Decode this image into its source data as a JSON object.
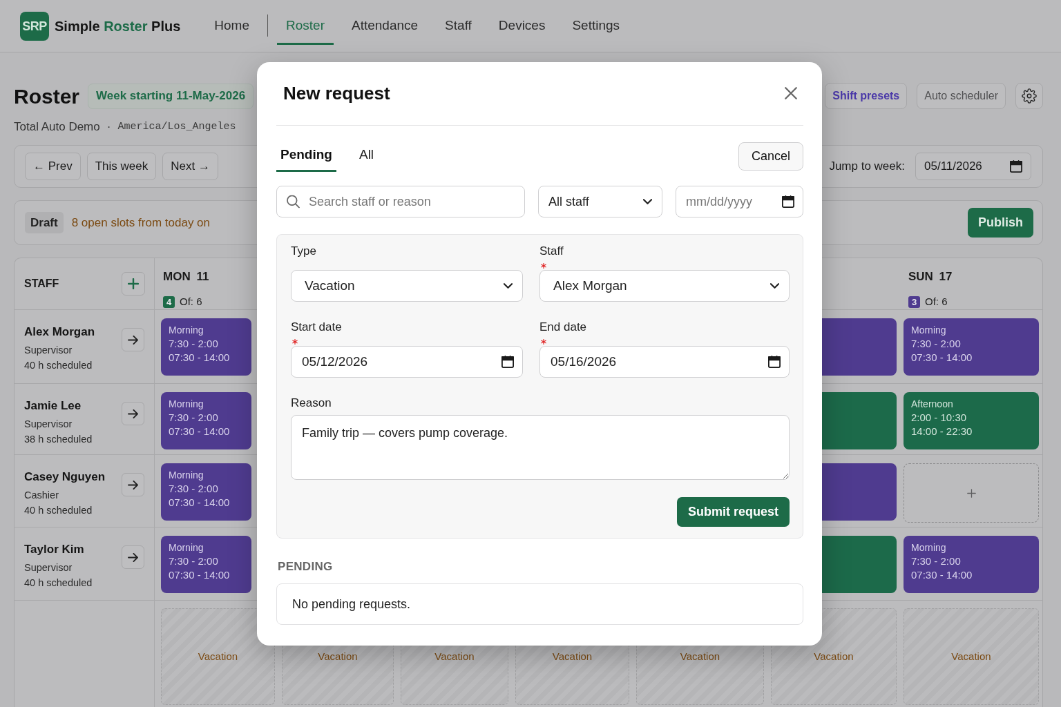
{
  "header": {
    "logo": "SRP",
    "brand": [
      {
        "text": "Simple",
        "accent": false
      },
      {
        "text": "Roster",
        "accent": true
      },
      {
        "text": "Plus",
        "accent": false
      }
    ],
    "nav": [
      {
        "label": "Home",
        "selected": false,
        "divider": true
      },
      {
        "label": "Roster",
        "selected": true,
        "divider": false
      },
      {
        "label": "Attendance",
        "selected": false,
        "divider": false
      },
      {
        "label": "Staff",
        "selected": false,
        "divider": false
      },
      {
        "label": "Devices",
        "selected": false,
        "divider": false
      },
      {
        "label": "Settings",
        "selected": false,
        "divider": false
      }
    ]
  },
  "page": {
    "title": "Roster",
    "week": "Week starting 11-May-2026",
    "subtitle": "Total Auto Demo",
    "separator": "·",
    "timezone": "America/Los_Angeles",
    "actions": [
      {
        "kind": "accent",
        "label": "Shift presets"
      },
      {
        "kind": "muted",
        "label": "Auto scheduler"
      },
      {
        "kind": "settings"
      }
    ]
  },
  "week_nav": {
    "buttons": [
      "← Prev",
      "This week",
      "Next →"
    ],
    "jump_label": "Jump to week:",
    "jump_value": "05/11/2026"
  },
  "status": {
    "badge": "Draft",
    "message": "8 open slots from today on",
    "publish": "Publish"
  },
  "roster": {
    "staff_heading": "STAFF",
    "days": [
      {
        "label": "MON 11",
        "count": "4",
        "capacity": "Of: 6",
        "color": "#1d6b48"
      },
      {
        "label": "SUN 17",
        "count": "3",
        "capacity": "Of: 6",
        "color": "#4f3b8f"
      }
    ],
    "rows": [
      {
        "name": "Alex Morgan",
        "role": "Supervisor",
        "hours": "40 h scheduled",
        "shifts": [
          {
            "kind": "morning",
            "title": "Morning",
            "time": "7:30 - 2:00",
            "time_24h": "07:30 - 14:00"
          },
          {
            "kind": "morning"
          },
          {
            "kind": "morning",
            "title": "Morning",
            "time": "7:30 - 2:00",
            "time_24h": "07:30 - 14:00"
          }
        ]
      },
      {
        "name": "Jamie Lee",
        "role": "Supervisor",
        "hours": "38 h scheduled",
        "shifts": [
          {
            "kind": "morning",
            "title": "Morning",
            "time": "7:30 - 2:00",
            "time_24h": "07:30 - 14:00"
          },
          {
            "kind": "afternoon"
          },
          {
            "kind": "afternoon",
            "title": "Afternoon",
            "time": "2:00 - 10:30",
            "time_24h": "14:00 - 22:30"
          }
        ]
      },
      {
        "name": "Casey Nguyen",
        "role": "Cashier",
        "hours": "40 h scheduled",
        "shifts": [
          {
            "kind": "morning",
            "title": "Morning",
            "time": "7:30 - 2:00",
            "time_24h": "07:30 - 14:00"
          },
          {
            "kind": "morning"
          },
          {
            "kind": "open"
          }
        ]
      },
      {
        "name": "Taylor Kim",
        "role": "Supervisor",
        "hours": "40 h scheduled",
        "shifts": [
          {
            "kind": "morning",
            "title": "Morning",
            "time": "7:30 - 2:00",
            "time_24h": "07:30 - 14:00"
          },
          {
            "kind": "afternoon"
          },
          {
            "kind": "morning",
            "title": "Morning",
            "time": "7:30 - 2:00",
            "time_24h": "07:30 - 14:00"
          }
        ]
      }
    ],
    "absences": [
      {
        "label": "Vacation"
      },
      {
        "label": "Vacation"
      },
      {
        "label": "Vacation"
      },
      {
        "label": "Vacation"
      },
      {
        "label": "Vacation"
      },
      {
        "label": "Vacation"
      },
      {
        "label": "Vacation"
      }
    ]
  },
  "modal": {
    "title": "New request",
    "tabs": [
      {
        "label": "Pending",
        "selected": true
      },
      {
        "label": "All",
        "selected": false
      }
    ],
    "cancel": "Cancel",
    "search_placeholder": "Search staff or reason",
    "staff_filter": "All staff",
    "date_placeholder": "mm/dd/yyyy",
    "form": {
      "fields": [
        {
          "kind": "select",
          "label": "Type",
          "value": "Vacation",
          "required": false
        },
        {
          "kind": "select",
          "label": "Staff",
          "value": "Alex Morgan",
          "required": true
        },
        {
          "kind": "date",
          "label": "Start date",
          "value": "05/12/2026",
          "required": true
        },
        {
          "kind": "date",
          "label": "End date",
          "value": "05/16/2026",
          "required": true
        },
        {
          "kind": "textarea",
          "label": "Reason",
          "value": "Family trip — covers pump coverage.",
          "required": false
        }
      ],
      "submit": "Submit request"
    },
    "pending_heading": "PENDING",
    "empty_message": "No pending requests."
  }
}
